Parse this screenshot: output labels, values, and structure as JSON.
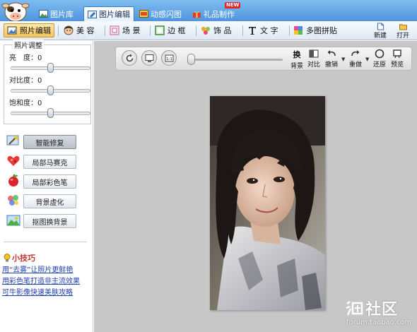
{
  "top_tabs": [
    {
      "label": "图片库",
      "icon": "image-library-icon"
    },
    {
      "label": "图片编辑",
      "icon": "image-edit-icon",
      "active": true
    },
    {
      "label": "动感闪图",
      "icon": "flash-animation-icon"
    },
    {
      "label": "礼品制作",
      "icon": "gift-icon"
    }
  ],
  "new_badge": "NEW",
  "sub_toolbar": {
    "items": [
      {
        "label": "照片编辑",
        "icon": "photo-edit-icon",
        "active": true
      },
      {
        "label": "美 容",
        "icon": "beauty-face-icon"
      },
      {
        "label": "场 景",
        "icon": "scene-icon"
      },
      {
        "label": "边 框",
        "icon": "frame-icon"
      },
      {
        "label": "饰 品",
        "icon": "accessory-icon"
      },
      {
        "label": "文 字",
        "icon": "text-icon"
      },
      {
        "label": "多图拼贴",
        "icon": "collage-icon"
      }
    ],
    "new_label": "新建",
    "open_label": "打开"
  },
  "adjust": {
    "title": "照片调整",
    "sliders": [
      {
        "label": "亮　度：",
        "value": "0",
        "level": 0.5
      },
      {
        "label": "对比度：",
        "value": "0",
        "level": 0.5
      },
      {
        "label": "饱和度：",
        "value": "0",
        "level": 0.5
      }
    ]
  },
  "tools": [
    {
      "label": "智能修复",
      "icon": "magic-wand-icon",
      "active": true
    },
    {
      "label": "局部马赛克",
      "icon": "mosaic-heart-icon"
    },
    {
      "label": "局部彩色笔",
      "icon": "color-apple-icon"
    },
    {
      "label": "背景虚化",
      "icon": "blur-dots-icon"
    },
    {
      "label": "抠图换背景",
      "icon": "cutout-image-icon"
    }
  ],
  "tips": {
    "title": "小技巧",
    "links": [
      "用“去雾”让照片更鲜艳",
      "用彩色笔打造非主流效果",
      "可牛影像快速美肤攻略"
    ]
  },
  "image_toolbar": {
    "zoom_level": 0.0,
    "buttons": [
      {
        "label": "背景",
        "glyph": "换"
      },
      {
        "label": "对比",
        "icon": "compare-icon"
      },
      {
        "label": "撤销",
        "icon": "undo-icon"
      },
      {
        "label": "重做",
        "icon": "redo-icon"
      },
      {
        "label": "还原",
        "icon": "restore-icon"
      },
      {
        "label": "预览",
        "icon": "preview-icon"
      }
    ],
    "actual_size_label": "1:1"
  },
  "watermark": {
    "brand": "社区",
    "url": "forum.taobao.com"
  }
}
